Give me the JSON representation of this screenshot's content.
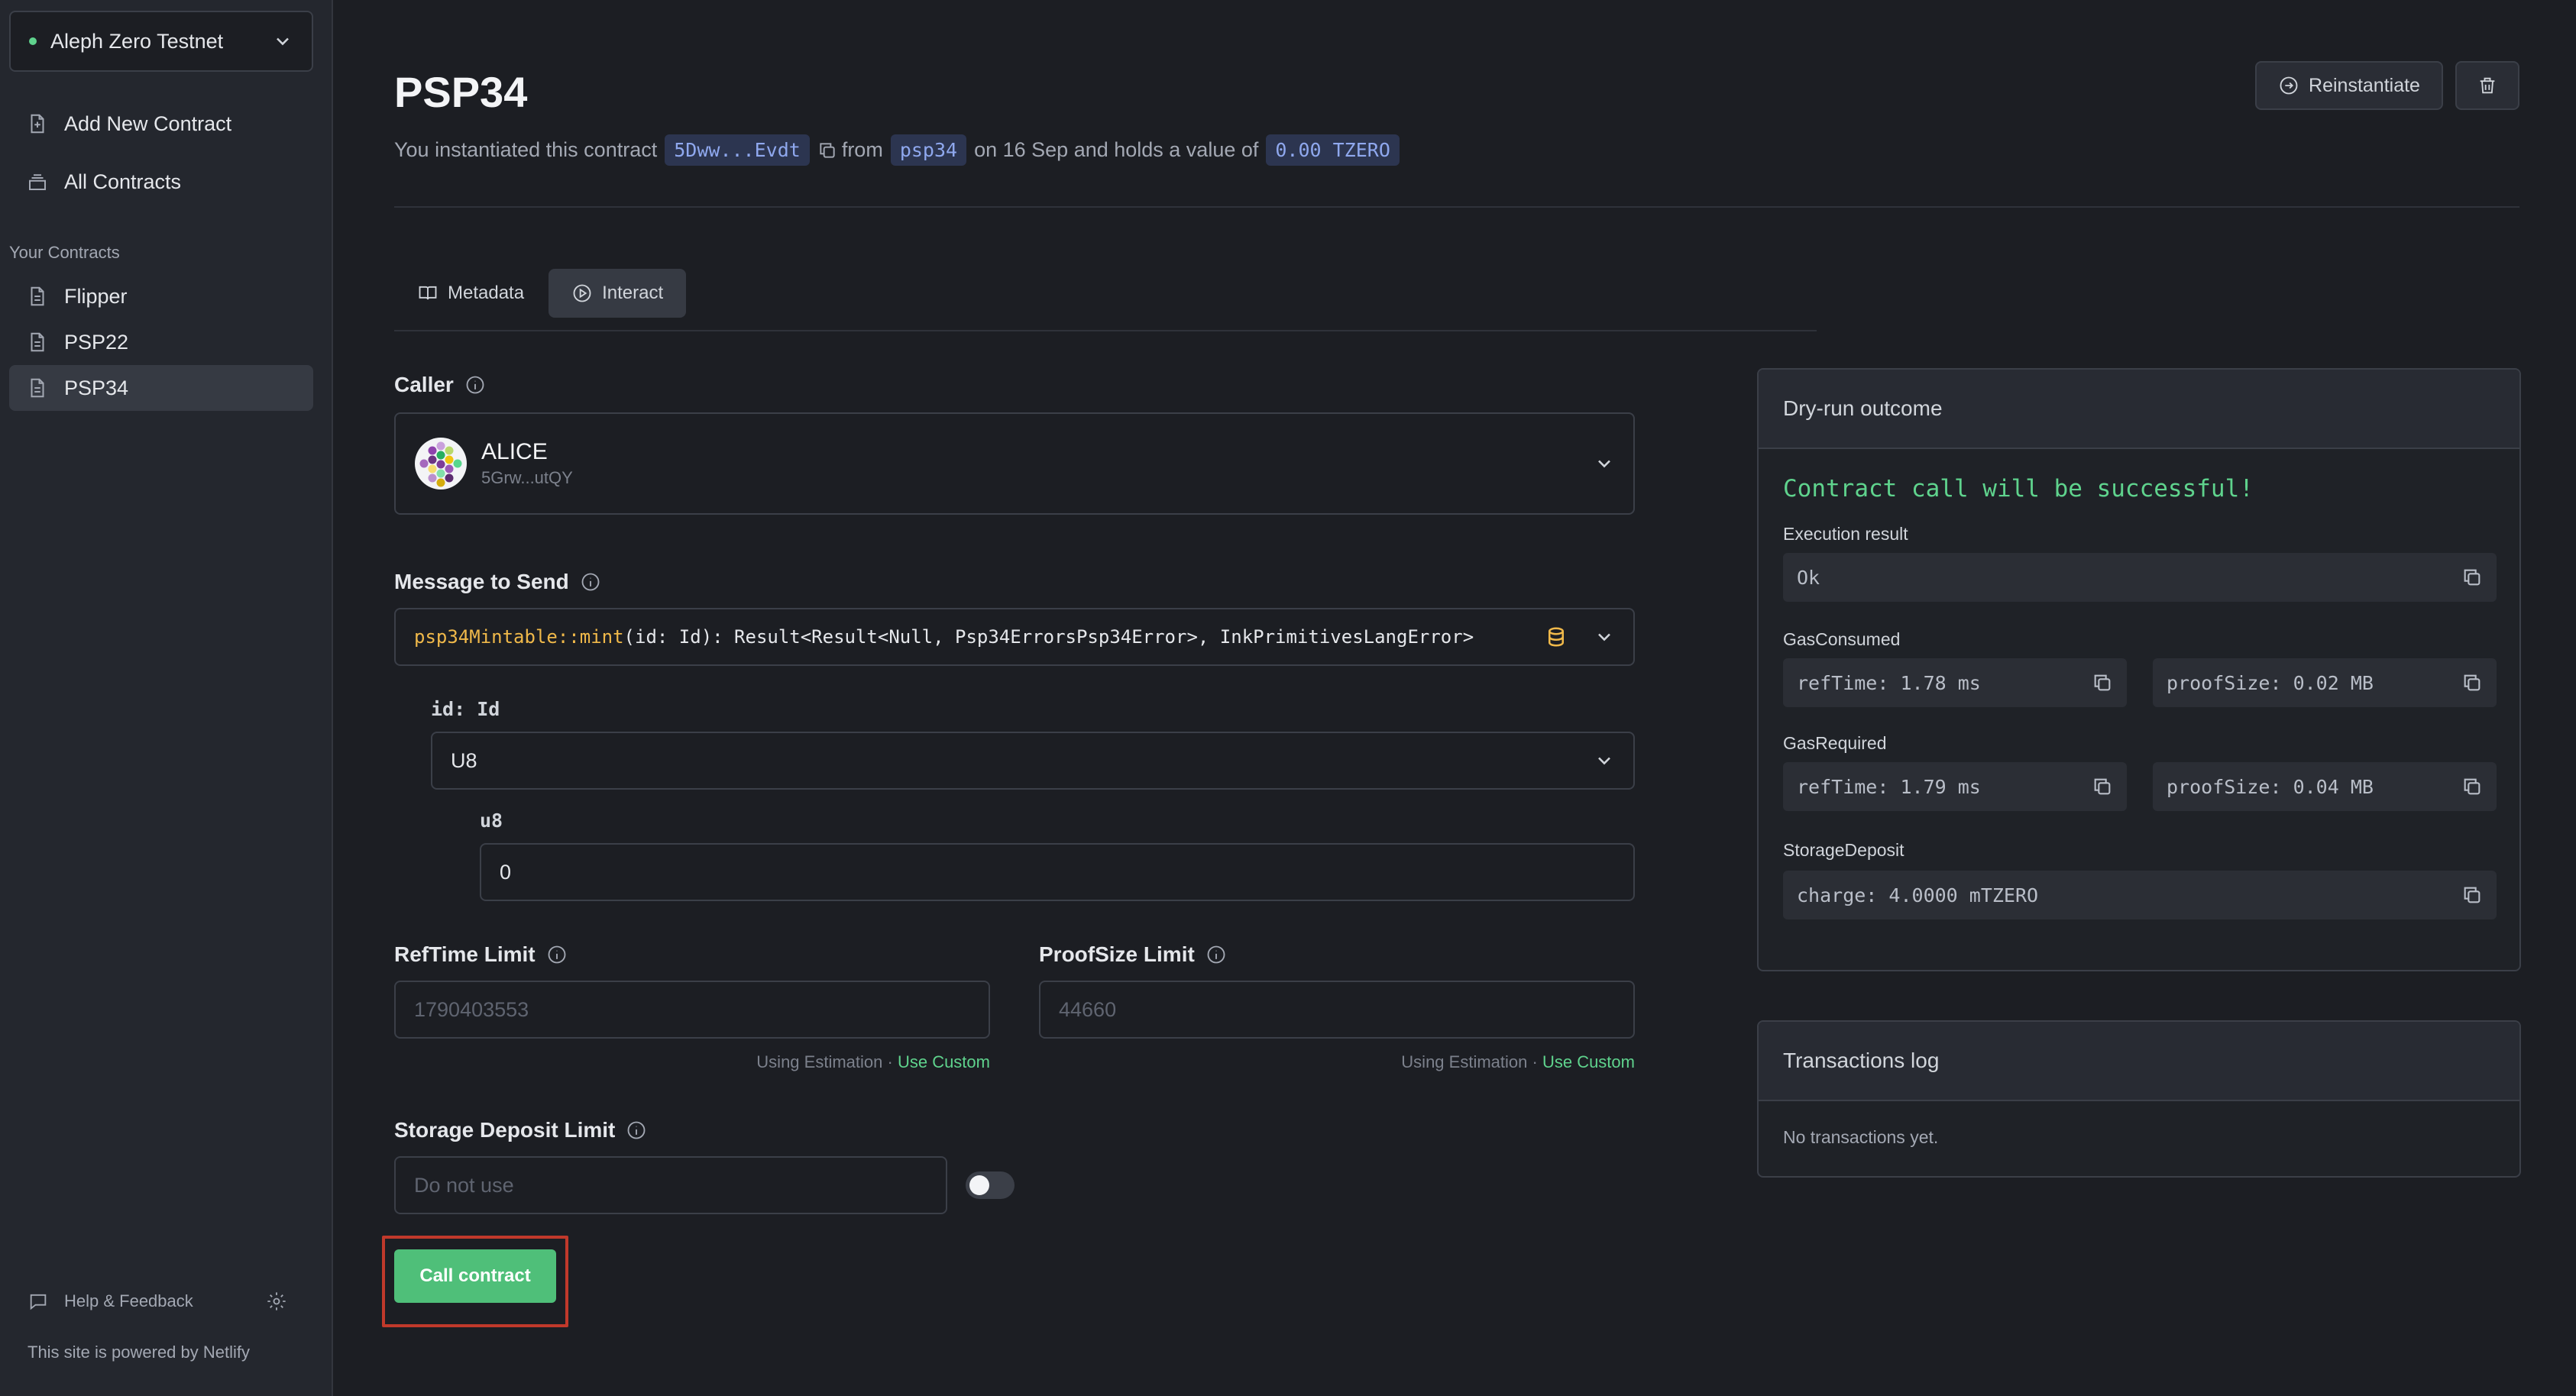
{
  "sidebar": {
    "network": "Aleph Zero Testnet",
    "nav": [
      {
        "label": "Add New Contract",
        "icon": "file-plus-icon"
      },
      {
        "label": "All Contracts",
        "icon": "stack-icon"
      }
    ],
    "section_title": "Your Contracts",
    "contracts": [
      {
        "label": "Flipper",
        "active": false
      },
      {
        "label": "PSP22",
        "active": false
      },
      {
        "label": "PSP34",
        "active": true
      }
    ],
    "help_label": "Help & Feedback",
    "powered_by": "This site is powered by Netlify"
  },
  "header": {
    "title": "PSP34",
    "sub_prefix": "You instantiated this contract",
    "address": "5Dww...Evdt",
    "sub_from": "from",
    "code_name": "psp34",
    "sub_date": "on 16 Sep and holds a value of",
    "value": "0.00 TZERO",
    "reinstantiate_label": "Reinstantiate"
  },
  "tabs": [
    {
      "label": "Metadata",
      "active": false
    },
    {
      "label": "Interact",
      "active": true
    }
  ],
  "form": {
    "caller_label": "Caller",
    "caller_name": "ALICE",
    "caller_address": "5Grw...utQY",
    "message_label": "Message to Send",
    "message_name": "psp34Mintable::mint",
    "message_signature": "(id: Id): Result<Result<Null, Psp34ErrorsPsp34Error>, InkPrimitivesLangError>",
    "arg_label": "id: Id",
    "arg_variant": "U8",
    "u8_label": "u8",
    "u8_value": "0",
    "reftime_label": "RefTime Limit",
    "reftime_placeholder": "1790403553",
    "proofsize_label": "ProofSize Limit",
    "proofsize_placeholder": "44660",
    "estimation_text": "Using Estimation",
    "separator": "·",
    "use_custom": "Use Custom",
    "storage_label": "Storage Deposit Limit",
    "storage_placeholder": "Do not use",
    "call_button": "Call contract"
  },
  "dry_run": {
    "title": "Dry-run outcome",
    "status": "Contract call will be successful!",
    "execution_label": "Execution result",
    "execution_value": "Ok",
    "gas_consumed_label": "GasConsumed",
    "gas_consumed_reftime": "refTime: 1.78 ms",
    "gas_consumed_proofsize": "proofSize: 0.02 MB",
    "gas_required_label": "GasRequired",
    "gas_required_reftime": "refTime: 1.79 ms",
    "gas_required_proofsize": "proofSize: 0.04 MB",
    "storage_label": "StorageDeposit",
    "storage_value": "charge: 4.0000 mTZERO"
  },
  "transactions": {
    "title": "Transactions log",
    "empty": "No transactions yet."
  },
  "colors": {
    "background": "#1c1e23",
    "sidebar": "#24272e",
    "accent_green": "#5fd38d",
    "chip_blue": "#8fa8ee",
    "message_yellow": "#f0b94a",
    "highlight_red": "#c0392b"
  }
}
